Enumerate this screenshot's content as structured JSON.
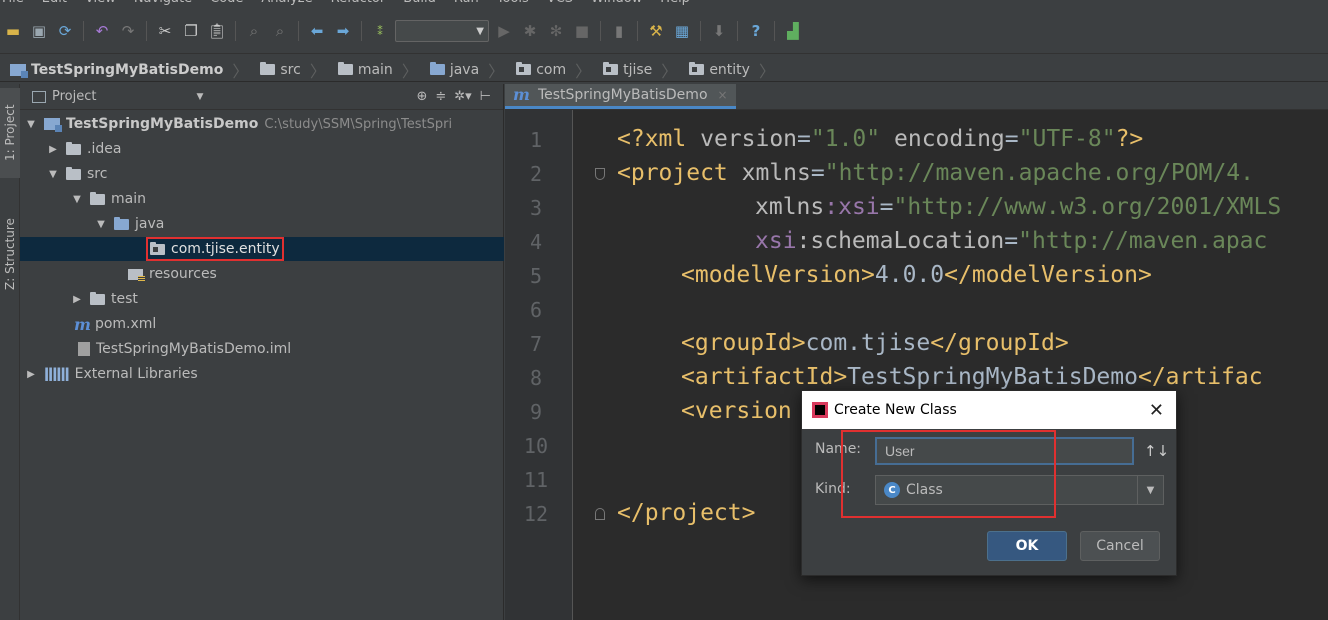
{
  "menubar": {
    "items": [
      "File",
      "Edit",
      "View",
      "Navigate",
      "Code",
      "Analyze",
      "Refactor",
      "Build",
      "Run",
      "Tools",
      "VCS",
      "Window",
      "Help"
    ]
  },
  "navbar": {
    "crumbs": [
      "TestSpringMyBatisDemo",
      "src",
      "main",
      "java",
      "com",
      "tjise",
      "entity"
    ]
  },
  "sidestrip": {
    "project_tab": "1: Project",
    "structure_tab": "Z: Structure"
  },
  "project_panel": {
    "title": "Project",
    "tree": {
      "root_name": "TestSpringMyBatisDemo",
      "root_path": "C:\\study\\SSM\\Spring\\TestSpri",
      "idea": ".idea",
      "src": "src",
      "main": "main",
      "java": "java",
      "package": "com.tjise.entity",
      "resources": "resources",
      "test": "test",
      "pom": "pom.xml",
      "iml": "TestSpringMyBatisDemo.iml",
      "libraries": "External Libraries"
    }
  },
  "editor": {
    "tab_label": "TestSpringMyBatisDemo",
    "line_numbers": [
      "1",
      "2",
      "3",
      "4",
      "5",
      "6",
      "7",
      "8",
      "9",
      "10",
      "11",
      "12"
    ],
    "lines": {
      "l1_open": "<?xml ",
      "l1_attr1": "version",
      "l1_eq1": "=",
      "l1_val1": "\"1.0\"",
      "l1_sp": " ",
      "l1_attr2": "encoding",
      "l1_eq2": "=",
      "l1_val2": "\"UTF-8\"",
      "l1_close": "?>",
      "l2_tag": "<project ",
      "l2_attr": "xmlns",
      "l2_eq": "=",
      "l2_val": "\"http://maven.apache.org/POM/4.",
      "l3_attr": "xmlns",
      "l3_ns": ":xsi",
      "l3_eq": "=",
      "l3_val": "\"http://www.w3.org/2001/XMLS",
      "l4_ns": "xsi",
      "l4_attr": ":schemaLocation",
      "l4_eq": "=",
      "l4_val": "\"http://maven.apac",
      "l5_open": "<modelVersion>",
      "l5_text": "4.0.0",
      "l5_close": "</modelVersion>",
      "l7_open": "<groupId>",
      "l7_text": "com.tjise",
      "l7_close": "</groupId>",
      "l8_open": "<artifactId>",
      "l8_text": "TestSpringMyBatisDemo",
      "l8_close": "</artifac",
      "l9_open": "<version",
      "l12_close": "</project>"
    }
  },
  "dialog": {
    "title": "Create New Class",
    "name_label": "Name:",
    "name_value": "User",
    "kind_label": "Kind:",
    "kind_value": "Class",
    "kind_icon_letter": "C",
    "ok_label": "OK",
    "cancel_label": "Cancel"
  },
  "colors": {
    "highlight": "#e03030",
    "accent": "#4a88c7"
  }
}
